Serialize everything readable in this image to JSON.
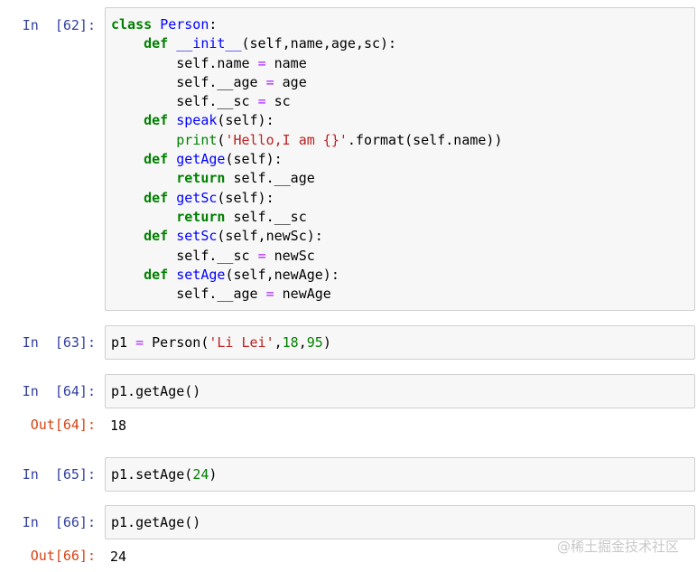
{
  "cells": [
    {
      "in_prompt": "In  [62]:",
      "code": [
        [
          [
            "kw",
            "class"
          ],
          [
            "t",
            " "
          ],
          [
            "cls",
            "Person"
          ],
          [
            "t",
            ":"
          ]
        ],
        [
          [
            "t",
            "    "
          ],
          [
            "kw",
            "def"
          ],
          [
            "t",
            " "
          ],
          [
            "fn",
            "__init__"
          ],
          [
            "t",
            "(self,name,age,sc):"
          ]
        ],
        [
          [
            "t",
            "        self.name "
          ],
          [
            "op",
            "="
          ],
          [
            "t",
            " name"
          ]
        ],
        [
          [
            "t",
            "        self.__age "
          ],
          [
            "op",
            "="
          ],
          [
            "t",
            " age"
          ]
        ],
        [
          [
            "t",
            "        self.__sc "
          ],
          [
            "op",
            "="
          ],
          [
            "t",
            " sc"
          ]
        ],
        [
          [
            "t",
            "    "
          ],
          [
            "kw",
            "def"
          ],
          [
            "t",
            " "
          ],
          [
            "fn",
            "speak"
          ],
          [
            "t",
            "(self):"
          ]
        ],
        [
          [
            "t",
            "        "
          ],
          [
            "bi",
            "print"
          ],
          [
            "t",
            "("
          ],
          [
            "str",
            "'Hello,I am {}'"
          ],
          [
            "t",
            ".format(self.name))"
          ]
        ],
        [
          [
            "t",
            "    "
          ],
          [
            "kw",
            "def"
          ],
          [
            "t",
            " "
          ],
          [
            "fn",
            "getAge"
          ],
          [
            "t",
            "(self):"
          ]
        ],
        [
          [
            "t",
            "        "
          ],
          [
            "kw",
            "return"
          ],
          [
            "t",
            " self.__age"
          ]
        ],
        [
          [
            "t",
            "    "
          ],
          [
            "kw",
            "def"
          ],
          [
            "t",
            " "
          ],
          [
            "fn",
            "getSc"
          ],
          [
            "t",
            "(self):"
          ]
        ],
        [
          [
            "t",
            "        "
          ],
          [
            "kw",
            "return"
          ],
          [
            "t",
            " self.__sc"
          ]
        ],
        [
          [
            "t",
            "    "
          ],
          [
            "kw",
            "def"
          ],
          [
            "t",
            " "
          ],
          [
            "fn",
            "setSc"
          ],
          [
            "t",
            "(self,newSc):"
          ]
        ],
        [
          [
            "t",
            "        self.__sc "
          ],
          [
            "op",
            "="
          ],
          [
            "t",
            " newSc"
          ]
        ],
        [
          [
            "t",
            "    "
          ],
          [
            "kw",
            "def"
          ],
          [
            "t",
            " "
          ],
          [
            "fn",
            "setAge"
          ],
          [
            "t",
            "(self,newAge):"
          ]
        ],
        [
          [
            "t",
            "        self.__age "
          ],
          [
            "op",
            "="
          ],
          [
            "t",
            " newAge"
          ]
        ]
      ]
    },
    {
      "in_prompt": "In  [63]:",
      "code": [
        [
          [
            "t",
            "p1 "
          ],
          [
            "op",
            "="
          ],
          [
            "t",
            " Person("
          ],
          [
            "str",
            "'Li Lei'"
          ],
          [
            "t",
            ","
          ],
          [
            "num",
            "18"
          ],
          [
            "t",
            ","
          ],
          [
            "num",
            "95"
          ],
          [
            "t",
            ")"
          ]
        ]
      ]
    },
    {
      "in_prompt": "In  [64]:",
      "code": [
        [
          [
            "t",
            "p1.getAge()"
          ]
        ]
      ],
      "out_prompt": "Out[64]:",
      "output": "18"
    },
    {
      "in_prompt": "In  [65]:",
      "code": [
        [
          [
            "t",
            "p1.setAge("
          ],
          [
            "num",
            "24"
          ],
          [
            "t",
            ")"
          ]
        ]
      ]
    },
    {
      "in_prompt": "In  [66]:",
      "code": [
        [
          [
            "t",
            "p1.getAge()"
          ]
        ]
      ],
      "out_prompt": "Out[66]:",
      "output": "24"
    }
  ],
  "watermark": "@稀土掘金技术社区",
  "colors": {
    "in_prompt": "#303f9f",
    "out_prompt": "#d84315",
    "keyword": "#008000",
    "name": "#0000ff",
    "string": "#ba2121",
    "number": "#008000",
    "operator": "#aa22ff",
    "cell_background": "#f7f7f7",
    "cell_border": "#cfcfcf"
  }
}
